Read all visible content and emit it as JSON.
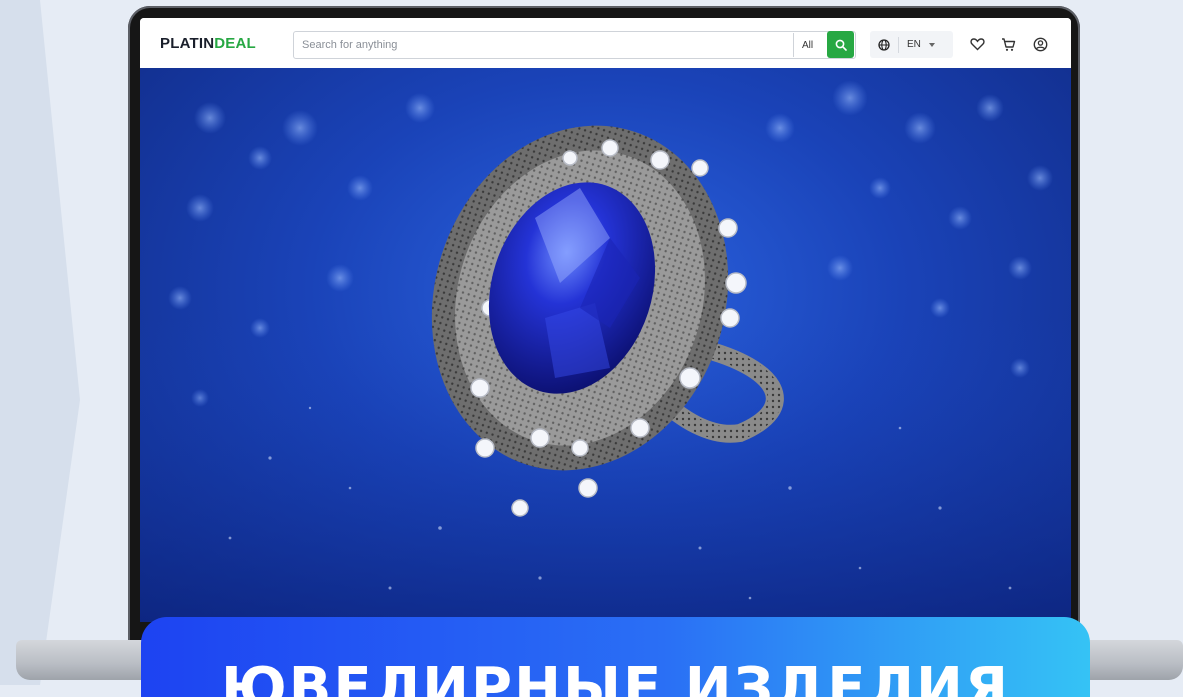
{
  "header": {
    "logo_part1": "PLATIN",
    "logo_part2": "DEAL",
    "search_placeholder": "Search for anything",
    "category_selected": "All",
    "language": "EN"
  },
  "hero": {
    "image_icon": "sapphire-ring-photo"
  },
  "banner": {
    "text": "ЮВЕЛИРНЫЕ ИЗДЕЛИЯ"
  },
  "colors": {
    "accent_green": "#27a843",
    "banner_start": "#1d43f2",
    "banner_end": "#35c3f5",
    "hero_blue": "#1a43b8"
  }
}
